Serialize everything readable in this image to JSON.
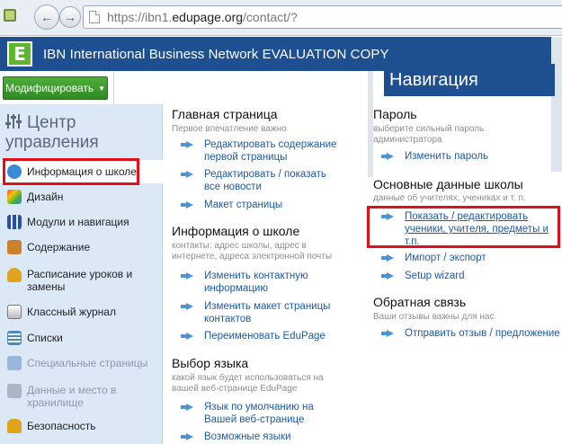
{
  "browser": {
    "url_prefix": "https://ibn1.",
    "url_host": "edupage.org",
    "url_path": "/contact/?"
  },
  "app": {
    "title": "IBN International Business Network EVALUATION COPY",
    "logo_letter": "E"
  },
  "toolbar": {
    "modify_label": "Модифицировать",
    "nav_heading": "Навигация"
  },
  "sidebar": {
    "title_line1": "Центр",
    "title_line2": "управления",
    "items": [
      {
        "label": "Информация о школе",
        "icon": "globe-icon",
        "color": "#3a8ad6"
      },
      {
        "label": "Дизайн",
        "icon": "palette-icon",
        "color": "#d24b8f"
      },
      {
        "label": "Модули и навигация",
        "icon": "modules-icon",
        "color": "#2b4f9a"
      },
      {
        "label": "Содержание",
        "icon": "content-icon",
        "color": "#c9822a"
      },
      {
        "label": "Расписание уроков и замены",
        "icon": "bell-icon",
        "color": "#e0a41e"
      },
      {
        "label": "Классный журнал",
        "icon": "journal-icon",
        "color": "#6f6f6f"
      },
      {
        "label": "Списки",
        "icon": "list-icon",
        "color": "#4a8ac0"
      },
      {
        "label": "Специальные страницы",
        "icon": "cubes-icon",
        "color": "#9ab7dc"
      },
      {
        "label": "Данные и место в хранилище",
        "icon": "storage-icon",
        "color": "#a9b7c6"
      },
      {
        "label": "Безопасность",
        "icon": "lock-icon",
        "color": "#e0a41e"
      }
    ]
  },
  "main": {
    "home": {
      "title": "Главная страница",
      "desc": "Первое впечатление важно",
      "links": [
        "Редактировать содержание первой страницы",
        "Редактировать / показать все новости",
        "Макет страницы"
      ]
    },
    "school_info": {
      "title": "Информация о школе",
      "desc": "контакты: адрес школы, адрес в интернете, адреса электронной почты",
      "links": [
        "Изменить контактную информацию",
        "Изменить макет страницы контактов",
        "Переименовать EduPage"
      ]
    },
    "language": {
      "title": "Выбор языка",
      "desc": "какой язык будет использоваться на вашей веб-странице EduPage",
      "links": [
        "Язык по умолчанию на Вашей веб-странице",
        "Возможные языки"
      ]
    },
    "password": {
      "title": "Пароль",
      "desc": "выберите сильный пароль администратора",
      "links": [
        "Изменить пароль"
      ]
    },
    "school_data": {
      "title": "Основные данные школы",
      "desc": "данные об учителях, учениках и т. п.",
      "links": [
        "Показать / редактировать ученики, учителя, предметы и т.п.",
        "Импорт / экспорт",
        "Setup wizard"
      ]
    },
    "feedback": {
      "title": "Обратная связь",
      "desc": "Ваши отзывы важны для нас",
      "links": [
        "Отправить отзыв / предложение"
      ]
    }
  }
}
